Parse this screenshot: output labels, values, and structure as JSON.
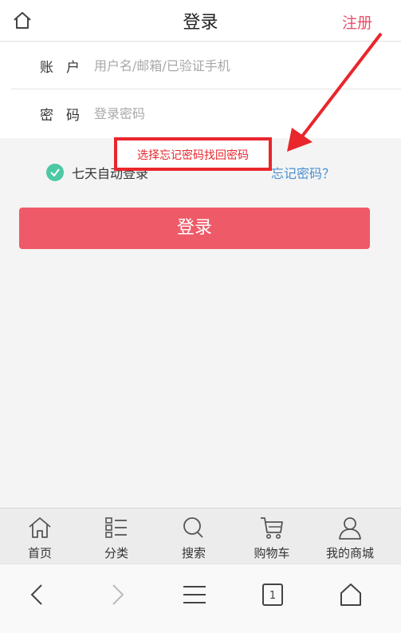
{
  "header": {
    "title": "登录",
    "register_label": "注册"
  },
  "form": {
    "account_label": "账户",
    "account_placeholder": "用户名/邮箱/已验证手机",
    "password_label": "密码",
    "password_placeholder": "登录密码"
  },
  "options": {
    "remember_label": "七天自动登录",
    "forgot_label": "忘记密码？"
  },
  "annotation": {
    "callout_text": "选择忘记密码找回密码"
  },
  "login_button": "登录",
  "tabbar": {
    "items": [
      {
        "label": "首页",
        "icon": "home-icon"
      },
      {
        "label": "分类",
        "icon": "category-icon"
      },
      {
        "label": "搜索",
        "icon": "search-icon"
      },
      {
        "label": "购物车",
        "icon": "cart-icon"
      },
      {
        "label": "我的商城",
        "icon": "user-icon"
      }
    ]
  },
  "browser": {
    "tab_count": "1"
  },
  "colors": {
    "accent": "#ee5a68",
    "register": "#e8506a",
    "check": "#4cc9a4",
    "link": "#4a8fd1",
    "annotation": "#e8262c"
  }
}
